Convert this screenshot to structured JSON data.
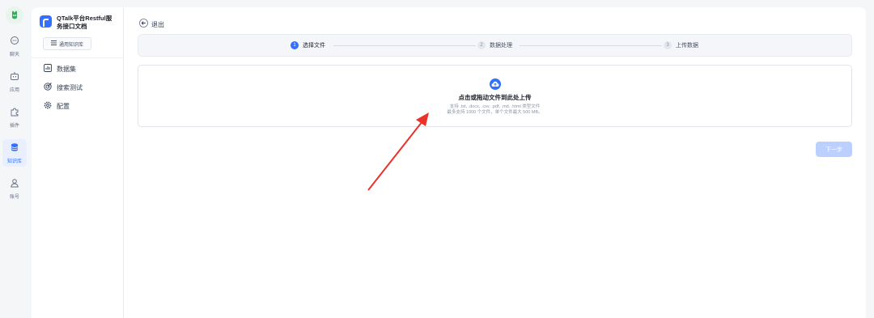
{
  "rail": {
    "items": [
      {
        "label": "聊天",
        "icon": "chat-icon"
      },
      {
        "label": "应用",
        "icon": "robot-icon"
      },
      {
        "label": "插件",
        "icon": "puzzle-icon"
      },
      {
        "label": "知识库",
        "icon": "database-icon",
        "active": true
      },
      {
        "label": "账号",
        "icon": "user-icon"
      }
    ]
  },
  "knowledge_base": {
    "title_line1": "QTalk平台Restful服",
    "title_line2": "务接口文档",
    "type_label": "通用知识库",
    "menu": [
      {
        "label": "数据集",
        "icon": "chart-icon"
      },
      {
        "label": "搜索测试",
        "icon": "target-icon"
      },
      {
        "label": "配置",
        "icon": "gear-icon"
      }
    ]
  },
  "main": {
    "back_label": "退出",
    "steps": [
      {
        "num": "1",
        "label": "选择文件",
        "active": true
      },
      {
        "num": "2",
        "label": "数据处理",
        "active": false
      },
      {
        "num": "3",
        "label": "上传数据",
        "active": false
      }
    ],
    "upload": {
      "title": "点击或拖动文件到此处上传",
      "supported": "支持 .txt, .docx, .csv, .pdf, .md, .html 类型文件",
      "limit": "最多支持 1000 个文件，单个文件最大 500 MB。"
    },
    "next_button": "下一步"
  },
  "colors": {
    "accent": "#3370ff",
    "annotation_arrow": "#e8322a"
  }
}
